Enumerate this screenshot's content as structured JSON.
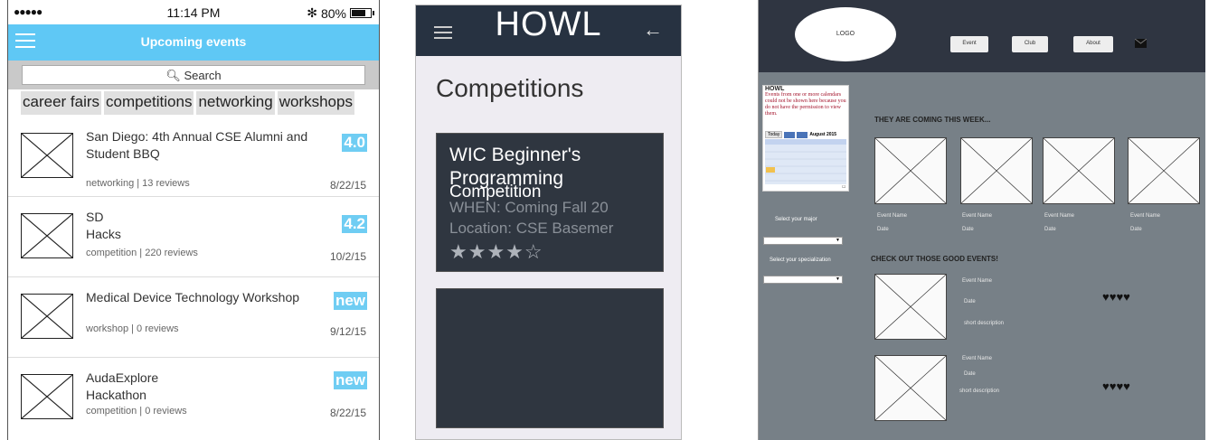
{
  "phone": {
    "status": {
      "signal": "●●●●●",
      "time": "11:14 PM",
      "bluetooth": "✻",
      "battery": "80%",
      "battery_level": 0.8
    },
    "app_bar_title": "Upcoming events",
    "search_placeholder": "Search",
    "chips": [
      "career fairs",
      "competitions",
      "networking",
      "workshops"
    ],
    "events": [
      {
        "name": "San Diego: 4th Annual CSE Alumni and Student BBQ",
        "meta": "networking | 13 reviews",
        "date": "8/22/15",
        "score": "4.0"
      },
      {
        "name": "SD\nHacks",
        "meta": "competition | 220 reviews",
        "date": "10/2/15",
        "score": "4.2"
      },
      {
        "name": "Medical Device Technology Workshop",
        "meta": "workshop | 0 reviews",
        "date": "9/12/15",
        "score": "new"
      },
      {
        "name": "AudaExplore\nHackathon",
        "meta": "competition | 0 reviews",
        "date": "8/22/15",
        "score": "new"
      }
    ]
  },
  "howl": {
    "title": "HOWL",
    "heading": "Competitions",
    "card": {
      "title_line1": "WIC Beginner's",
      "title_line2": "Programming",
      "title_line3": "Competition",
      "when": "WHEN: Coming Fall 20",
      "location": "Location: CSE Basemer",
      "rating": 4,
      "stars": "★★★★☆"
    }
  },
  "desktop": {
    "logo": "LOGO",
    "nav": [
      "Event",
      "Club",
      "About"
    ],
    "calendar": {
      "title": "HOWL",
      "message": "Events from one or more calendars could not be shown here because you do not have the permission to view them.",
      "today": "Today",
      "month": "August 2015"
    },
    "select_major": "Select your major",
    "select_specialization": "Select your specialization",
    "section_week": "THEY ARE COMING THIS WEEK...",
    "section_good": "CHECK OUT THOSE GOOD EVENTS!",
    "week_cards": [
      {
        "name": "Event Name",
        "date": "Date"
      },
      {
        "name": "Event Name",
        "date": "Date"
      },
      {
        "name": "Event Name",
        "date": "Date"
      },
      {
        "name": "Event Name",
        "date": "Date"
      }
    ],
    "good_events": [
      {
        "name": "Event Name",
        "date": "Date",
        "desc": "short description",
        "hearts": "♥♥♥♥"
      },
      {
        "name": "Event Name",
        "date": "Date",
        "desc": "short description",
        "hearts": "♥♥♥♥"
      }
    ]
  }
}
